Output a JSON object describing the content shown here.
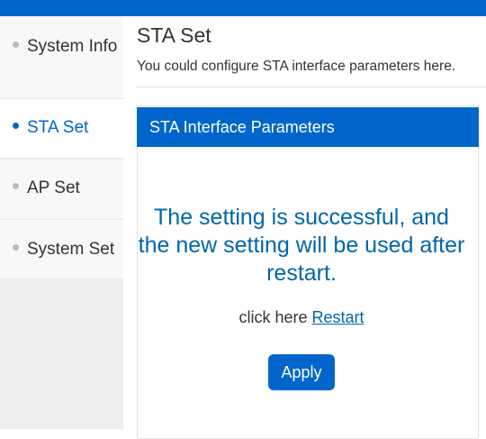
{
  "sidebar": {
    "items": [
      {
        "label": "System Info",
        "active": false
      },
      {
        "label": "STA Set",
        "active": true
      },
      {
        "label": "AP Set",
        "active": false
      },
      {
        "label": "System Set",
        "active": false
      }
    ]
  },
  "page": {
    "title": "STA Set",
    "description": "You could configure STA interface parameters here."
  },
  "panel": {
    "header": "STA Interface Parameters",
    "message": "The setting is successful, and the new setting will be used after restart.",
    "restart_prefix": "click here",
    "restart_link": "Restart",
    "apply_label": "Apply"
  },
  "colors": {
    "accent": "#0066cc",
    "message_text": "#0066aa",
    "sidebar_bg": "#eeeeee"
  }
}
